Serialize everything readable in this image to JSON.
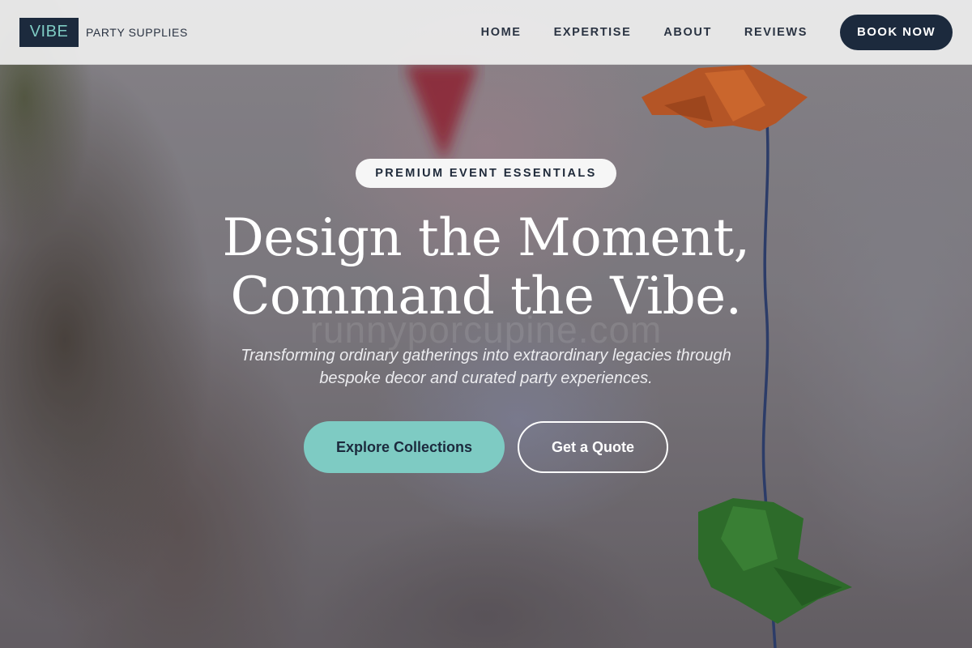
{
  "header": {
    "logo_text": "VIBE",
    "brand_tagline": "PARTY SUPPLIES",
    "nav": [
      {
        "label": "HOME"
      },
      {
        "label": "EXPERTISE"
      },
      {
        "label": "ABOUT"
      },
      {
        "label": "REVIEWS"
      }
    ],
    "cta_label": "BOOK NOW"
  },
  "hero": {
    "badge": "PREMIUM EVENT ESSENTIALS",
    "headline_line1": "Design the Moment,",
    "headline_line2": "Command the Vibe.",
    "watermark": "runnyporcupine.com",
    "subtitle_line1": "Transforming ordinary gatherings into extraordinary legacies through",
    "subtitle_line2": "bespoke decor and curated party experiences.",
    "primary_button": "Explore Collections",
    "secondary_button": "Get a Quote"
  },
  "colors": {
    "navy": "#1c2a3d",
    "teal": "#7ecbc3",
    "header_bg": "#eeeeee",
    "white": "#ffffff"
  }
}
